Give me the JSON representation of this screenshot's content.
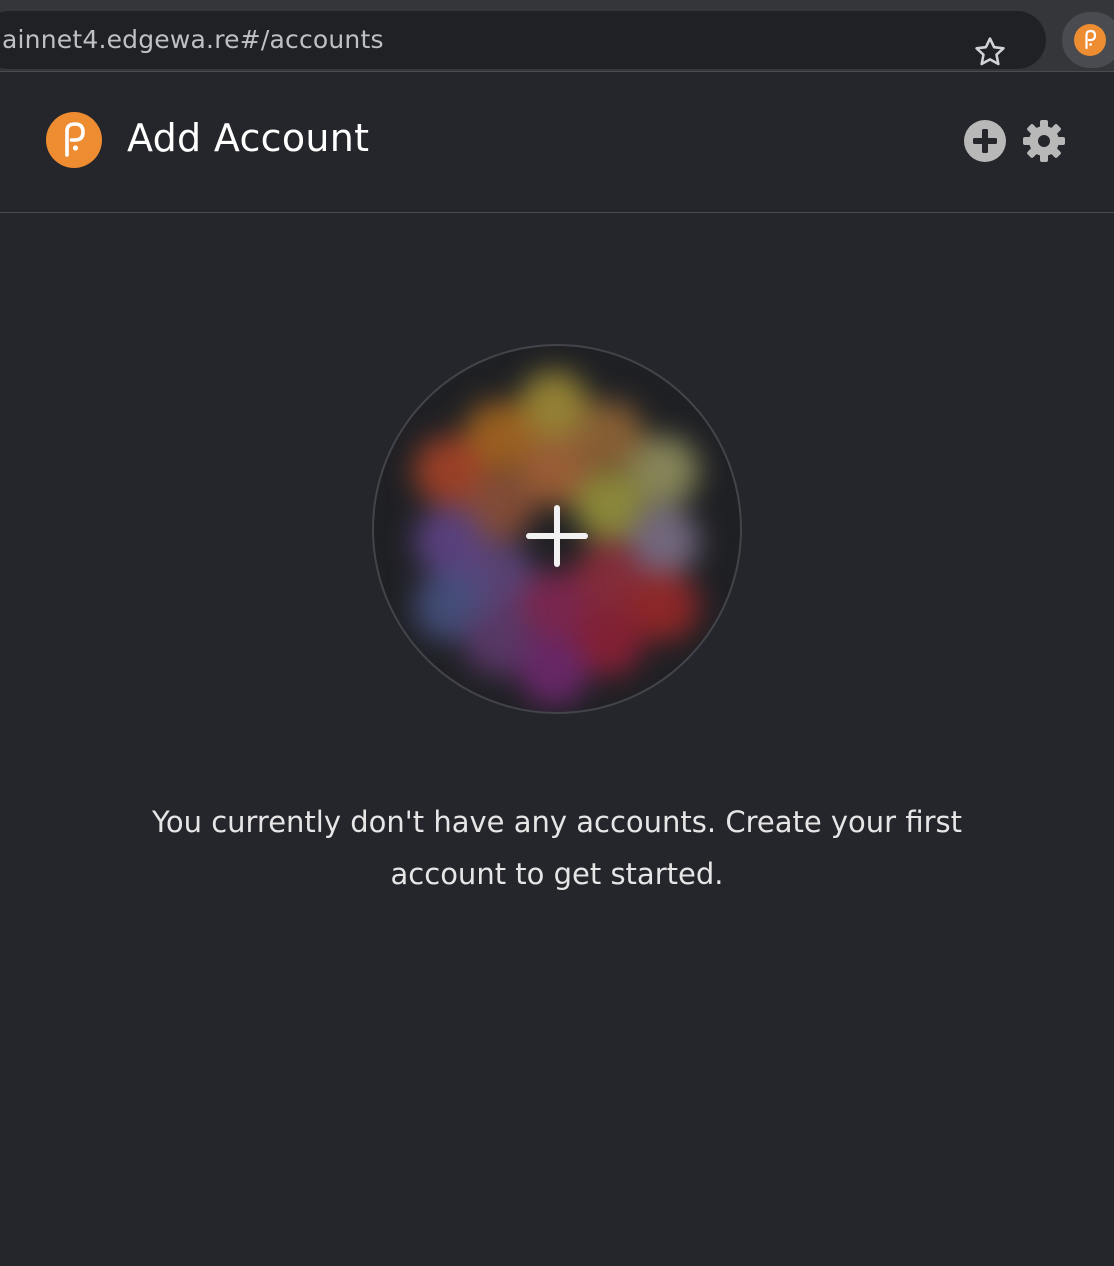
{
  "browser": {
    "address": "ainnet4.edgewa.re#/accounts",
    "star_icon": "star-outline-icon",
    "extension_icon": "polkadot-logo-icon"
  },
  "header": {
    "title": "Add Account",
    "logo_icon": "polkadot-logo-icon",
    "add_icon": "plus-circle-icon",
    "settings_icon": "gear-icon"
  },
  "main": {
    "identicon_icon": "plus-icon",
    "empty_message": "You currently don't have any accounts. Create your first account to get started."
  },
  "colors": {
    "background": "#25262c",
    "accent": "#ed8c30",
    "text": "#ffffff",
    "icon_gray": "#b8b8b8"
  }
}
